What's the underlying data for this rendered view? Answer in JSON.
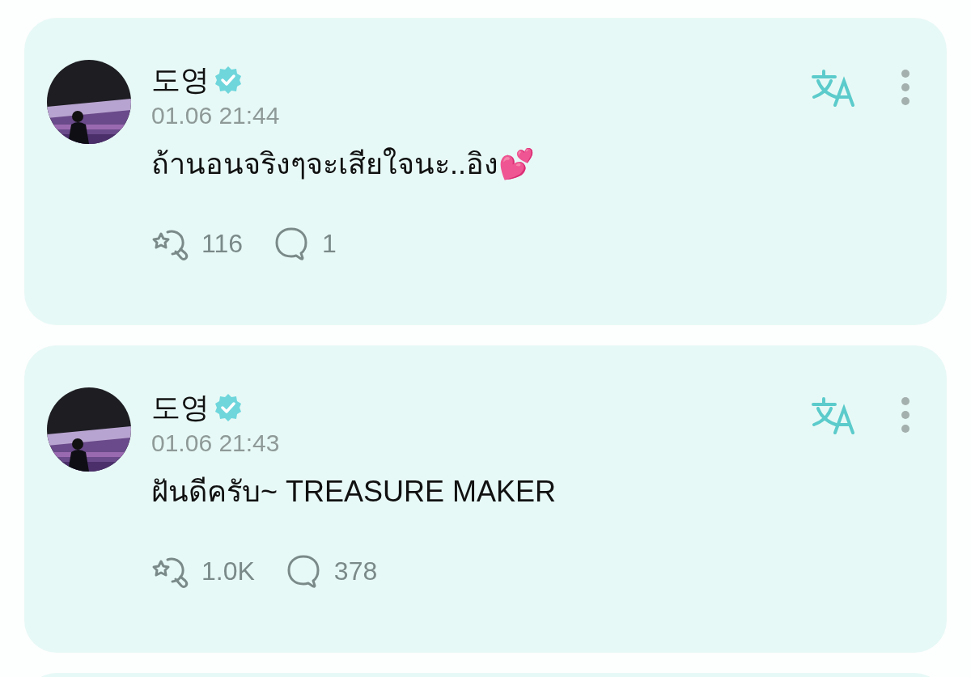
{
  "posts": [
    {
      "author": "도영",
      "verified": true,
      "time": "01.06 21:44",
      "text": "ถ้านอนจริงๆจะเสียใจนะ..อิง💕",
      "reposts": "116",
      "comments": "1"
    },
    {
      "author": "도영",
      "verified": true,
      "time": "01.06 21:43",
      "text": "ฝันดีครับ~ TREASURE MAKER",
      "reposts": "1.0K",
      "comments": "378"
    }
  ]
}
